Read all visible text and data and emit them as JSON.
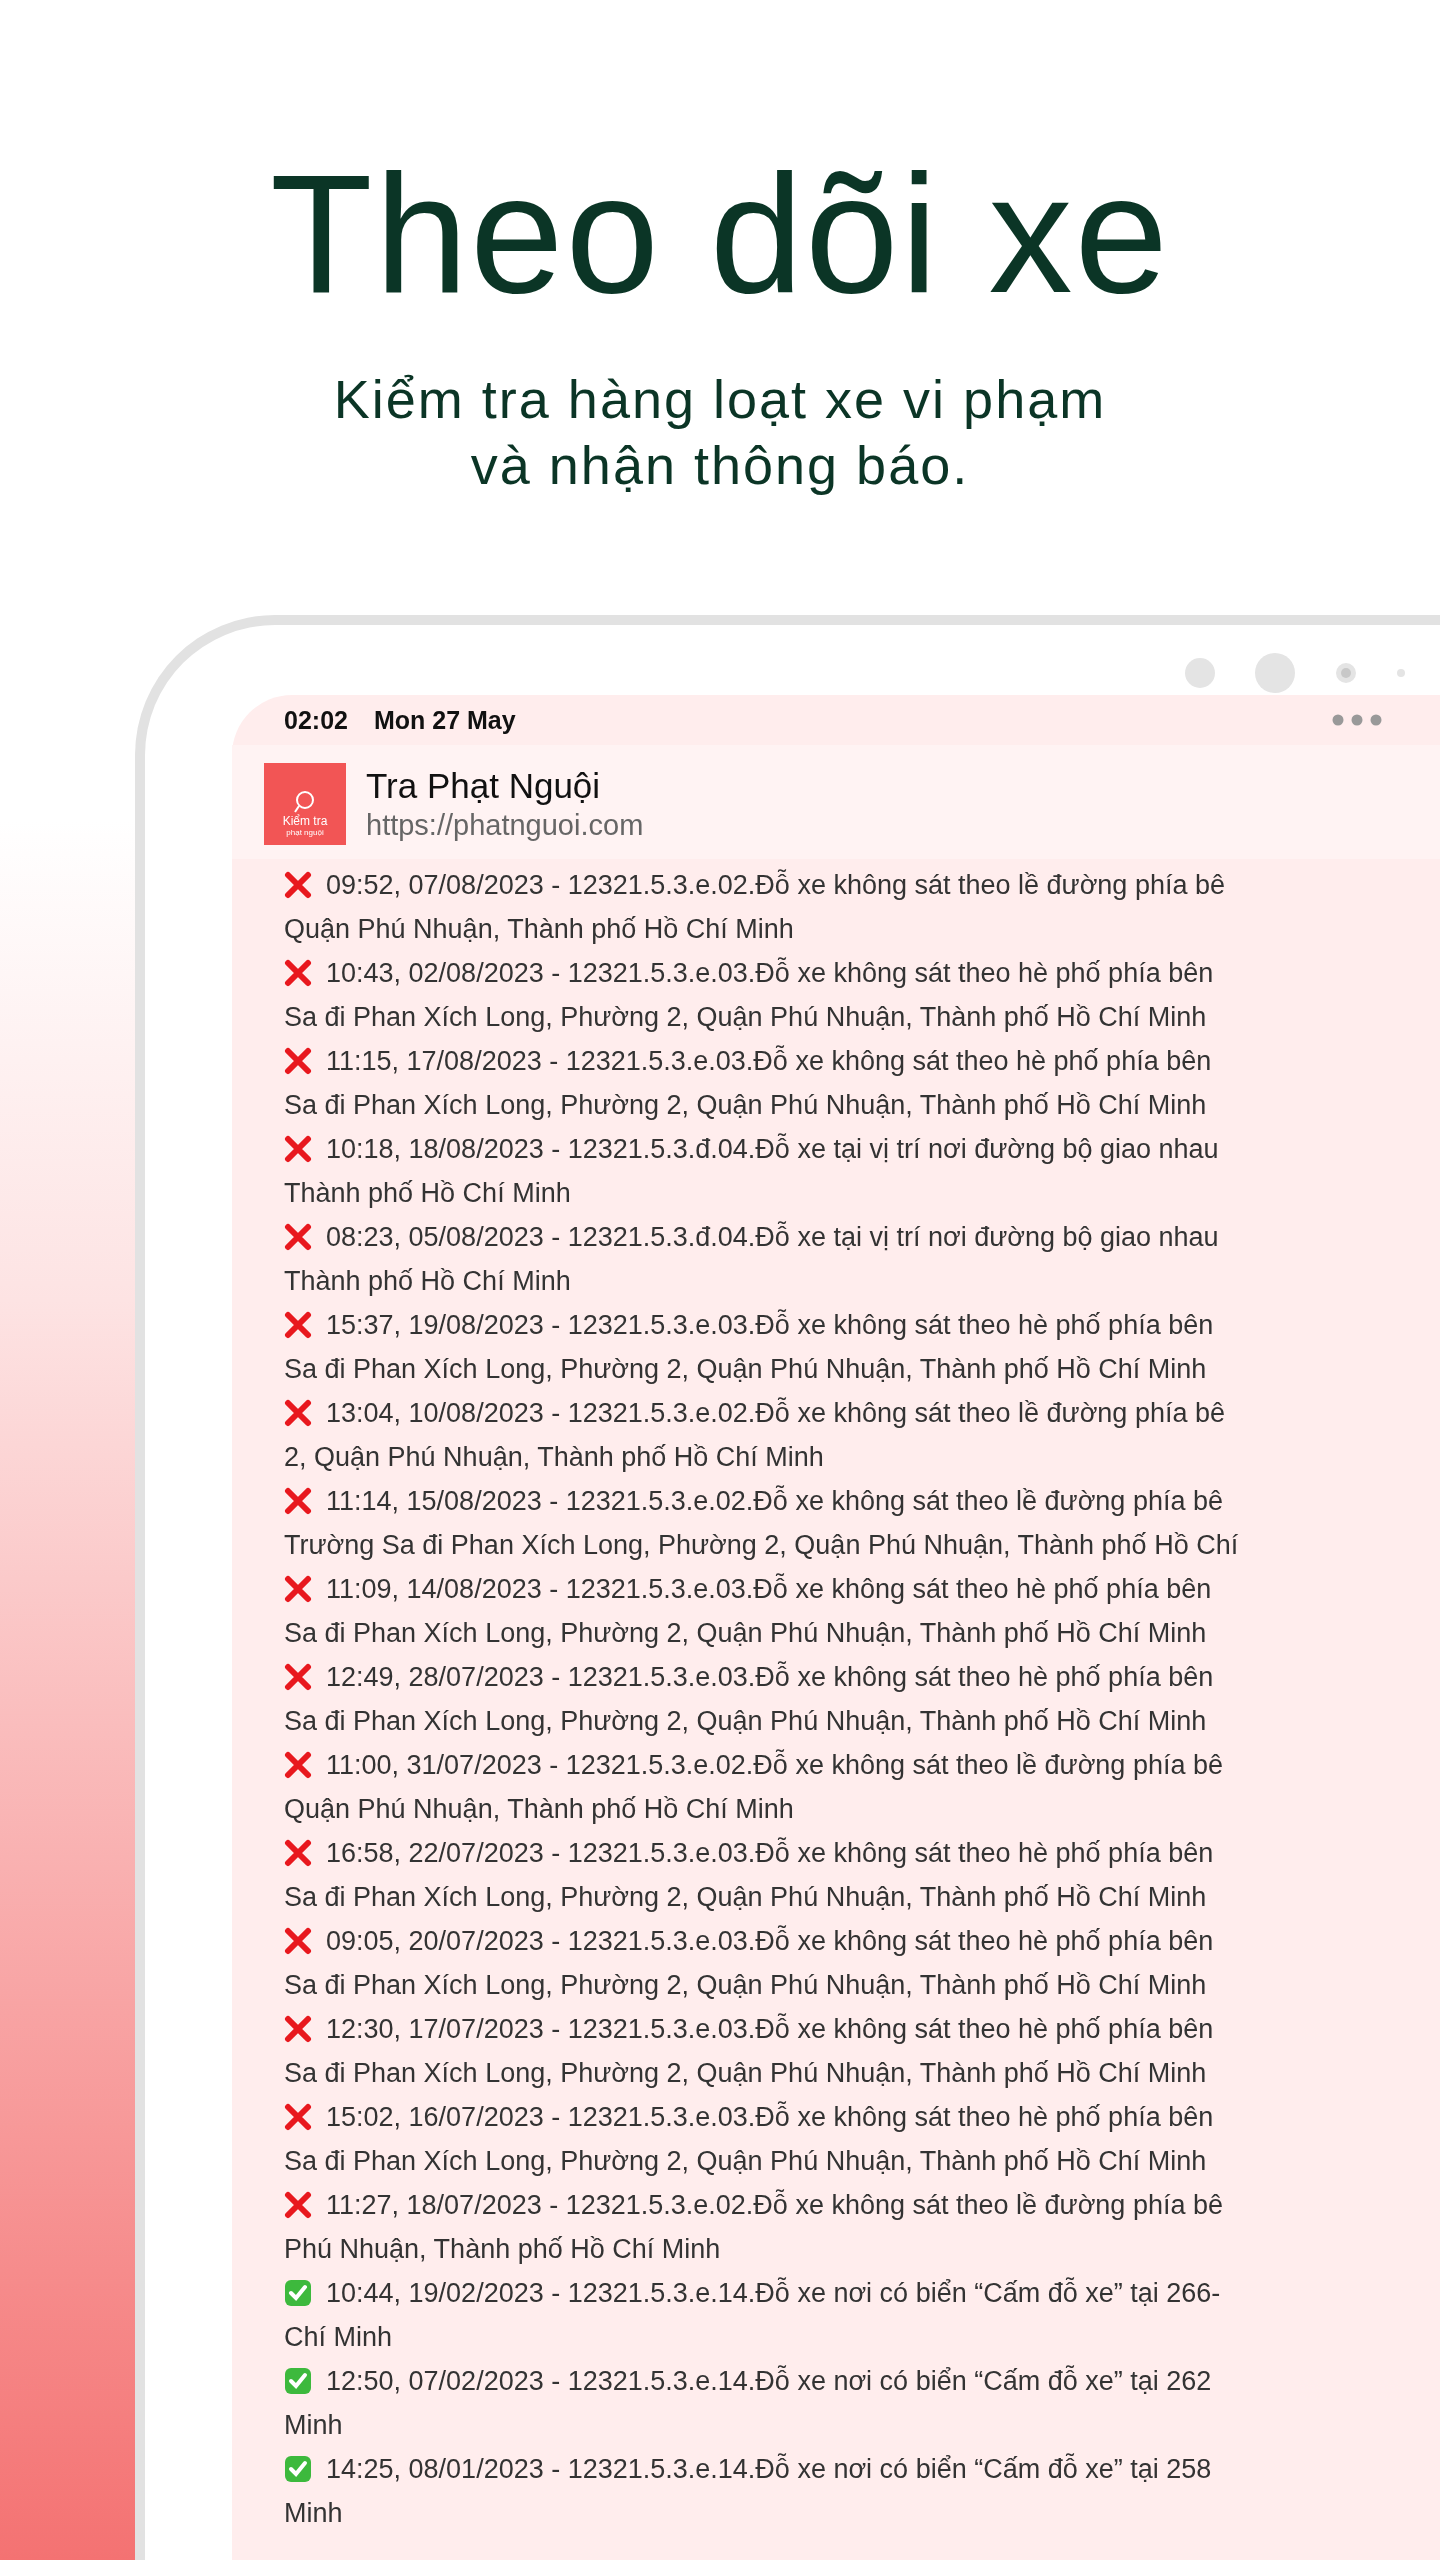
{
  "hero": {
    "title": "Theo dõi xe",
    "subtitle_lines": [
      "Kiểm tra hàng loạt xe vi phạm",
      "và nhận thông báo."
    ]
  },
  "status_bar": {
    "time": "02:02",
    "date": "Mon 27 May"
  },
  "app_header": {
    "logo_line1": "Kiểm tra",
    "logo_line2": "phạt nguội",
    "title": "Tra Phạt Nguội",
    "url": "https://phatnguoi.com"
  },
  "entries": [
    {
      "kind": "violation",
      "line1": "09:52, 07/08/2023 - 12321.5.3.e.02.Đỗ xe không sát theo lề đường phía bê",
      "line2": "Quận Phú Nhuận, Thành phố Hồ Chí Minh"
    },
    {
      "kind": "violation",
      "line1": "10:43, 02/08/2023 - 12321.5.3.e.03.Đỗ xe không sát theo hè phố phía bên",
      "line2": "Sa đi Phan Xích Long, Phường 2, Quận Phú Nhuận, Thành phố Hồ Chí Minh"
    },
    {
      "kind": "violation",
      "line1": "11:15, 17/08/2023 - 12321.5.3.e.03.Đỗ xe không sát theo hè phố phía bên",
      "line2": "Sa đi Phan Xích Long, Phường 2, Quận Phú Nhuận, Thành phố Hồ Chí Minh"
    },
    {
      "kind": "violation",
      "line1": "10:18, 18/08/2023 - 12321.5.3.đ.04.Đỗ xe tại vị trí nơi đường bộ giao nhau",
      "line2": "Thành phố Hồ Chí Minh"
    },
    {
      "kind": "violation",
      "line1": "08:23, 05/08/2023 - 12321.5.3.đ.04.Đỗ xe tại vị trí nơi đường bộ giao nhau",
      "line2": "Thành phố Hồ Chí Minh"
    },
    {
      "kind": "violation",
      "line1": "15:37, 19/08/2023 - 12321.5.3.e.03.Đỗ xe không sát theo hè phố phía bên",
      "line2": "Sa đi Phan Xích Long, Phường 2, Quận Phú Nhuận, Thành phố Hồ Chí Minh"
    },
    {
      "kind": "violation",
      "line1": "13:04, 10/08/2023 - 12321.5.3.e.02.Đỗ xe không sát theo lề đường phía bê",
      "line2": "2, Quận Phú Nhuận, Thành phố Hồ Chí Minh"
    },
    {
      "kind": "violation",
      "line1": "11:14, 15/08/2023 - 12321.5.3.e.02.Đỗ xe không sát theo lề đường phía bê",
      "line2": "Trường Sa đi Phan Xích Long, Phường 2, Quận Phú Nhuận, Thành phố Hồ Chí"
    },
    {
      "kind": "violation",
      "line1": "11:09, 14/08/2023 - 12321.5.3.e.03.Đỗ xe không sát theo hè phố phía bên",
      "line2": "Sa đi Phan Xích Long, Phường 2, Quận Phú Nhuận, Thành phố Hồ Chí Minh"
    },
    {
      "kind": "violation",
      "line1": "12:49, 28/07/2023 - 12321.5.3.e.03.Đỗ xe không sát theo hè phố phía bên",
      "line2": "Sa đi Phan Xích Long, Phường 2, Quận Phú Nhuận, Thành phố Hồ Chí Minh"
    },
    {
      "kind": "violation",
      "line1": "11:00, 31/07/2023 - 12321.5.3.e.02.Đỗ xe không sát theo lề đường phía bê",
      "line2": "Quận Phú Nhuận, Thành phố Hồ Chí Minh"
    },
    {
      "kind": "violation",
      "line1": "16:58, 22/07/2023 - 12321.5.3.e.03.Đỗ xe không sát theo hè phố phía bên",
      "line2": "Sa đi Phan Xích Long, Phường 2, Quận Phú Nhuận, Thành phố Hồ Chí Minh"
    },
    {
      "kind": "violation",
      "line1": "09:05, 20/07/2023 - 12321.5.3.e.03.Đỗ xe không sát theo hè phố phía bên",
      "line2": "Sa đi Phan Xích Long, Phường 2, Quận Phú Nhuận, Thành phố Hồ Chí Minh"
    },
    {
      "kind": "violation",
      "line1": "12:30, 17/07/2023 - 12321.5.3.e.03.Đỗ xe không sát theo hè phố phía bên",
      "line2": "Sa đi Phan Xích Long, Phường 2, Quận Phú Nhuận, Thành phố Hồ Chí Minh"
    },
    {
      "kind": "violation",
      "line1": "15:02, 16/07/2023 - 12321.5.3.e.03.Đỗ xe không sát theo hè phố phía bên",
      "line2": "Sa đi Phan Xích Long, Phường 2, Quận Phú Nhuận, Thành phố Hồ Chí Minh"
    },
    {
      "kind": "violation",
      "line1": "11:27, 18/07/2023 - 12321.5.3.e.02.Đỗ xe không sát theo lề đường phía bê",
      "line2": "Phú Nhuận, Thành phố Hồ Chí Minh"
    },
    {
      "kind": "paid",
      "line1": "10:44, 19/02/2023 - 12321.5.3.e.14.Đỗ xe nơi có biển “Cấm đỗ xe” tại 266-",
      "line2": "Chí Minh"
    },
    {
      "kind": "paid",
      "line1": "12:50, 07/02/2023 - 12321.5.3.e.14.Đỗ xe nơi có biển “Cấm đỗ xe” tại 262",
      "line2": "Minh"
    },
    {
      "kind": "paid",
      "line1": "14:25, 08/01/2023 - 12321.5.3.e.14.Đỗ xe nơi có biển “Cấm đỗ xe” tại 258",
      "line2": "Minh"
    }
  ]
}
